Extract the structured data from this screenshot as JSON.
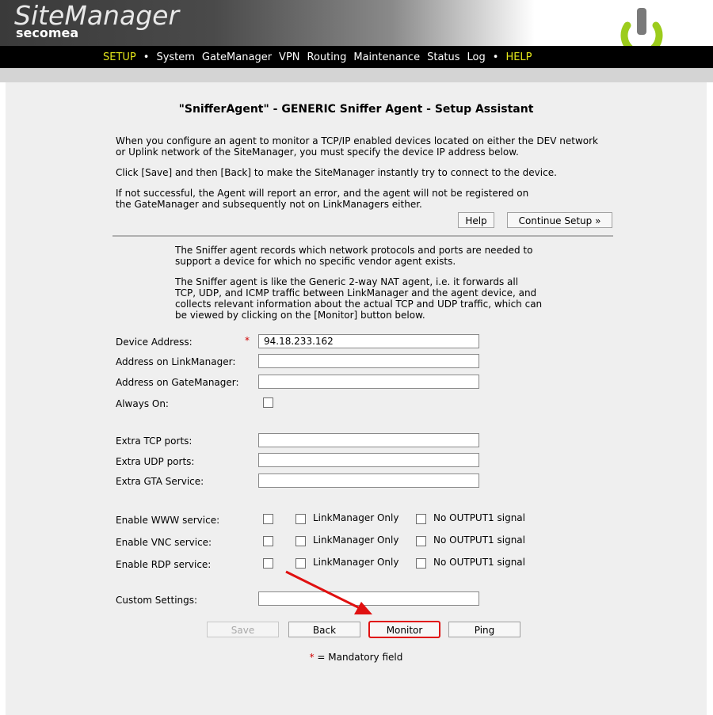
{
  "header": {
    "logo_main": "SiteManager",
    "logo_sub": "secomea"
  },
  "nav": {
    "items": [
      "SETUP",
      "System",
      "GateManager",
      "VPN",
      "Routing",
      "Maintenance",
      "Status",
      "Log",
      "HELP"
    ],
    "separator": "•"
  },
  "page": {
    "title": "\"SnifferAgent\" - GENERIC Sniffer Agent - Setup Assistant",
    "intro1_line1": "When you configure an agent to monitor a TCP/IP enabled devices located on either the DEV network",
    "intro1_line2": "or Uplink network of the SiteManager, you must specify the device IP address below.",
    "intro2": "Click [Save] and then [Back] to make the SiteManager instantly try to connect to the device.",
    "intro3_line1": "If not successful, the Agent will report an error, and the agent will not be registered on",
    "intro3_line2": "the GateManager and subsequently not on LinkManagers either.",
    "help_button": "Help",
    "continue_button": "Continue Setup »",
    "desc1_line1": "The Sniffer agent records which network protocols and ports are needed to",
    "desc1_line2": "support a device for which no specific vendor agent exists.",
    "desc2_line1": "The Sniffer agent is like the Generic 2-way NAT agent, i.e. it forwards all",
    "desc2_line2": "TCP, UDP, and ICMP traffic between LinkManager and the agent device, and",
    "desc2_line3": "collects relevant information about the actual TCP and UDP traffic, which can",
    "desc2_line4": "be viewed by clicking on the [Monitor] button below."
  },
  "form": {
    "device_address_label": "Device Address:",
    "device_address_value": "94.18.233.162",
    "mandatory_mark": "*",
    "linkmanager_address_label": "Address on LinkManager:",
    "linkmanager_address_value": "",
    "gatemanager_address_label": "Address on GateManager:",
    "gatemanager_address_value": "",
    "always_on_label": "Always On:",
    "extra_tcp_label": "Extra TCP ports:",
    "extra_tcp_value": "",
    "extra_udp_label": "Extra UDP ports:",
    "extra_udp_value": "",
    "extra_gta_label": "Extra GTA Service:",
    "extra_gta_value": "",
    "www_label": "Enable WWW service:",
    "vnc_label": "Enable VNC service:",
    "rdp_label": "Enable RDP service:",
    "linkmanager_only": "LinkManager Only",
    "no_output1": "No OUTPUT1 signal",
    "custom_settings_label": "Custom Settings:",
    "custom_settings_value": ""
  },
  "buttons": {
    "save": "Save",
    "back": "Back",
    "monitor": "Monitor",
    "ping": "Ping"
  },
  "footer": {
    "mandatory_mark": "*",
    "mandatory_text": " = Mandatory field"
  },
  "colors": {
    "accent_yellow": "#e5e81a",
    "required_red": "#d00000",
    "annotation_red": "#e01010"
  }
}
